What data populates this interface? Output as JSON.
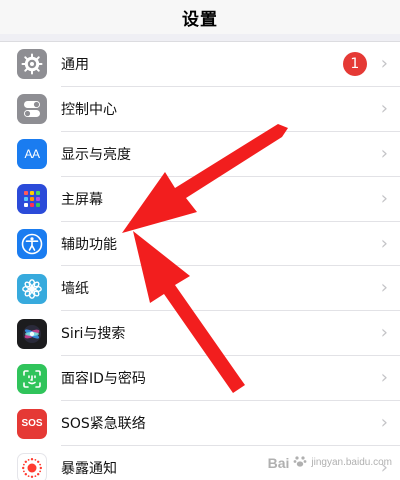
{
  "nav": {
    "title": "设置"
  },
  "items": [
    {
      "label": "通用",
      "icon": "gear-icon",
      "badge": "1"
    },
    {
      "label": "控制中心",
      "icon": "toggles-icon"
    },
    {
      "label": "显示与亮度",
      "icon": "display-brightness-icon",
      "icon_text": "AA"
    },
    {
      "label": "主屏幕",
      "icon": "home-screen-icon"
    },
    {
      "label": "辅助功能",
      "icon": "accessibility-icon"
    },
    {
      "label": "墙纸",
      "icon": "wallpaper-icon"
    },
    {
      "label": "Siri与搜索",
      "icon": "siri-icon"
    },
    {
      "label": "面容ID与密码",
      "icon": "face-id-icon"
    },
    {
      "label": "SOS紧急联络",
      "icon": "sos-icon",
      "icon_text": "SOS"
    },
    {
      "label": "暴露通知",
      "icon": "exposure-notification-icon"
    }
  ],
  "chevron": "›",
  "annotation": {
    "arrows": 2,
    "color": "#f21e1e"
  },
  "watermark": {
    "logo": "Bai",
    "text": "jingyan.baidu.com"
  }
}
